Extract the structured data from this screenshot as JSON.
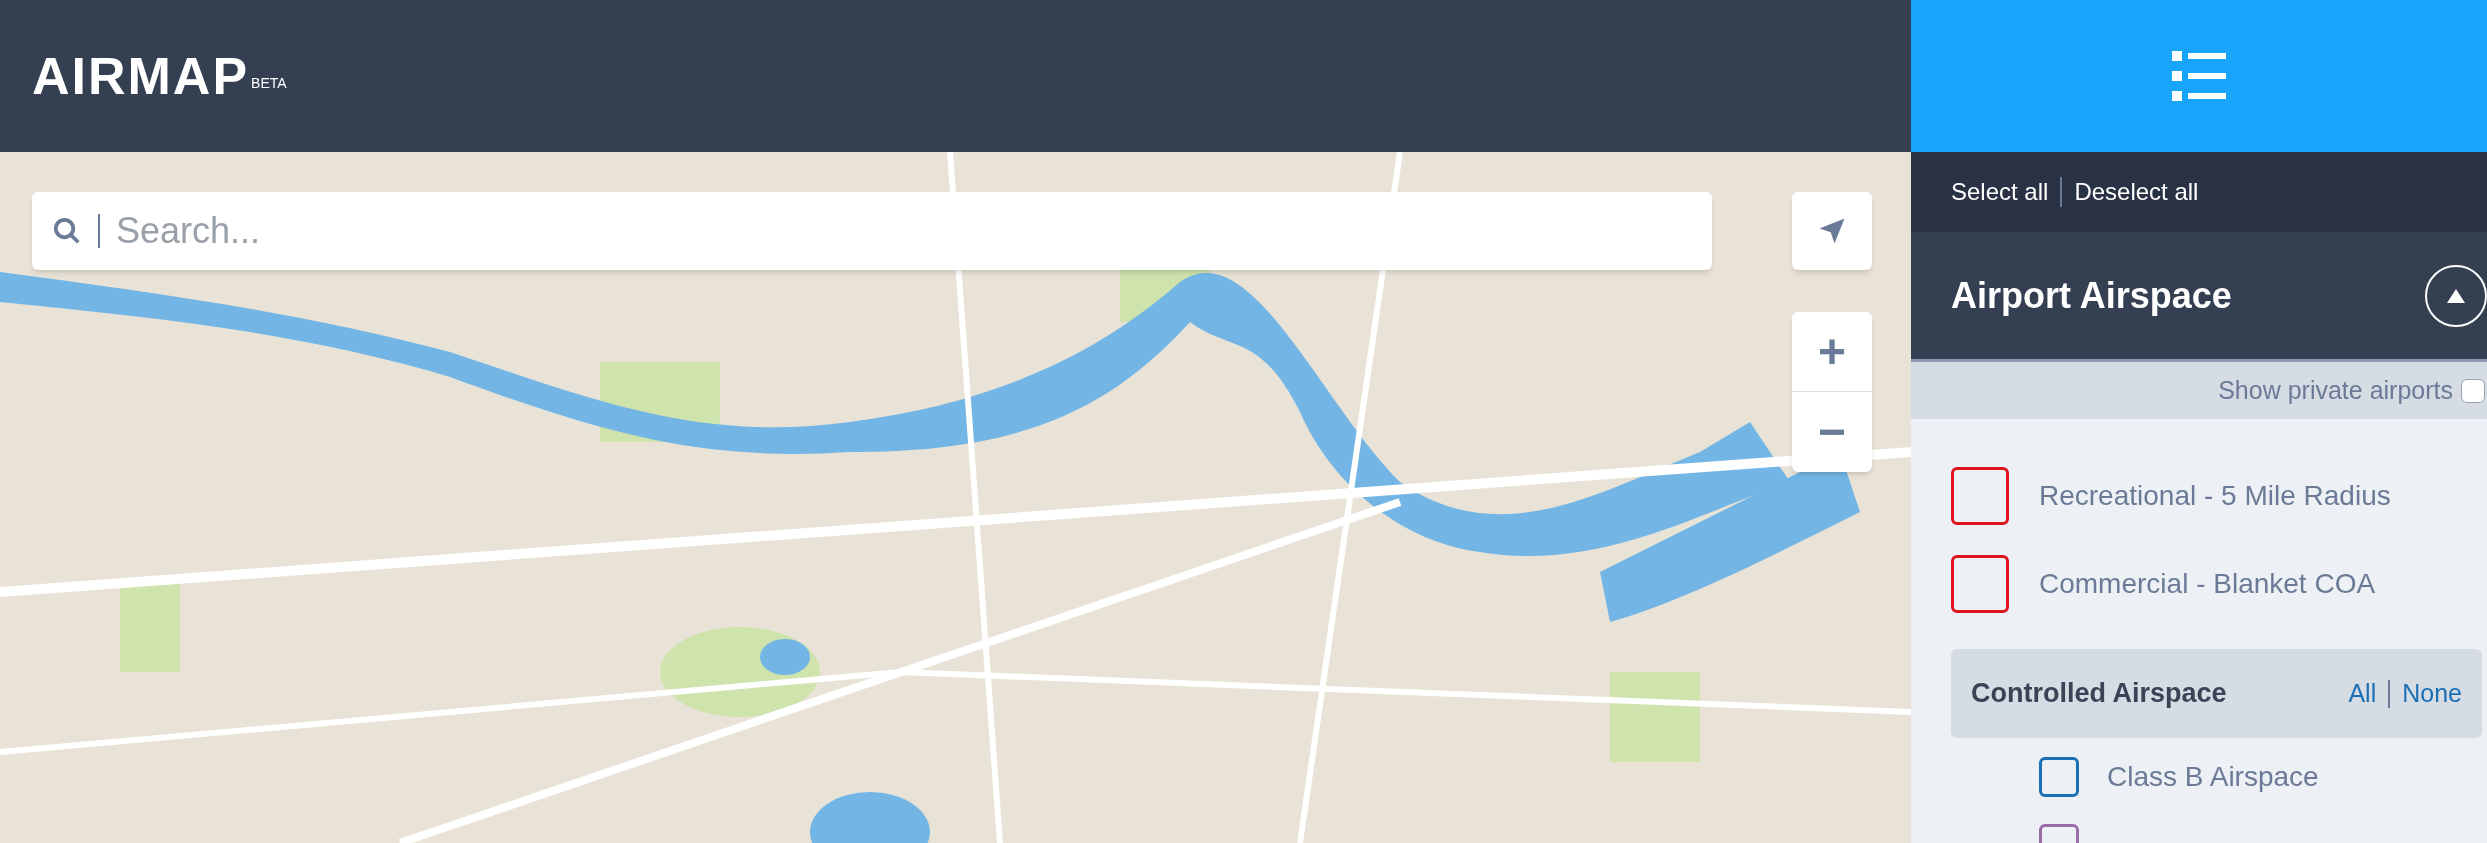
{
  "header": {
    "logo": "AIRMAP",
    "badge": "BETA"
  },
  "map": {
    "kind": "picture",
    "search": {
      "placeholder": "Search..."
    },
    "zoom": [
      "+",
      "−"
    ]
  },
  "panel": {
    "select_all": "Select all",
    "deselect_all": "Deselect all",
    "section": {
      "title": "Airport Airspace",
      "expanded": true,
      "private_label": "Show private airports",
      "private_checked": false,
      "items": [
        {
          "label": "Recreational - 5 Mile Radius",
          "checked": false,
          "color": "#e0141e"
        },
        {
          "label": "Commercial - Blanket COA",
          "checked": false,
          "color": "#e0141e"
        }
      ]
    },
    "group": {
      "title": "Controlled Airspace",
      "all": "All",
      "none": "None",
      "items": [
        {
          "label": "Class B Airspace",
          "checked": false,
          "color": "#1a6fb5"
        },
        {
          "checked": false,
          "color": "#9b6aa8"
        }
      ]
    }
  }
}
